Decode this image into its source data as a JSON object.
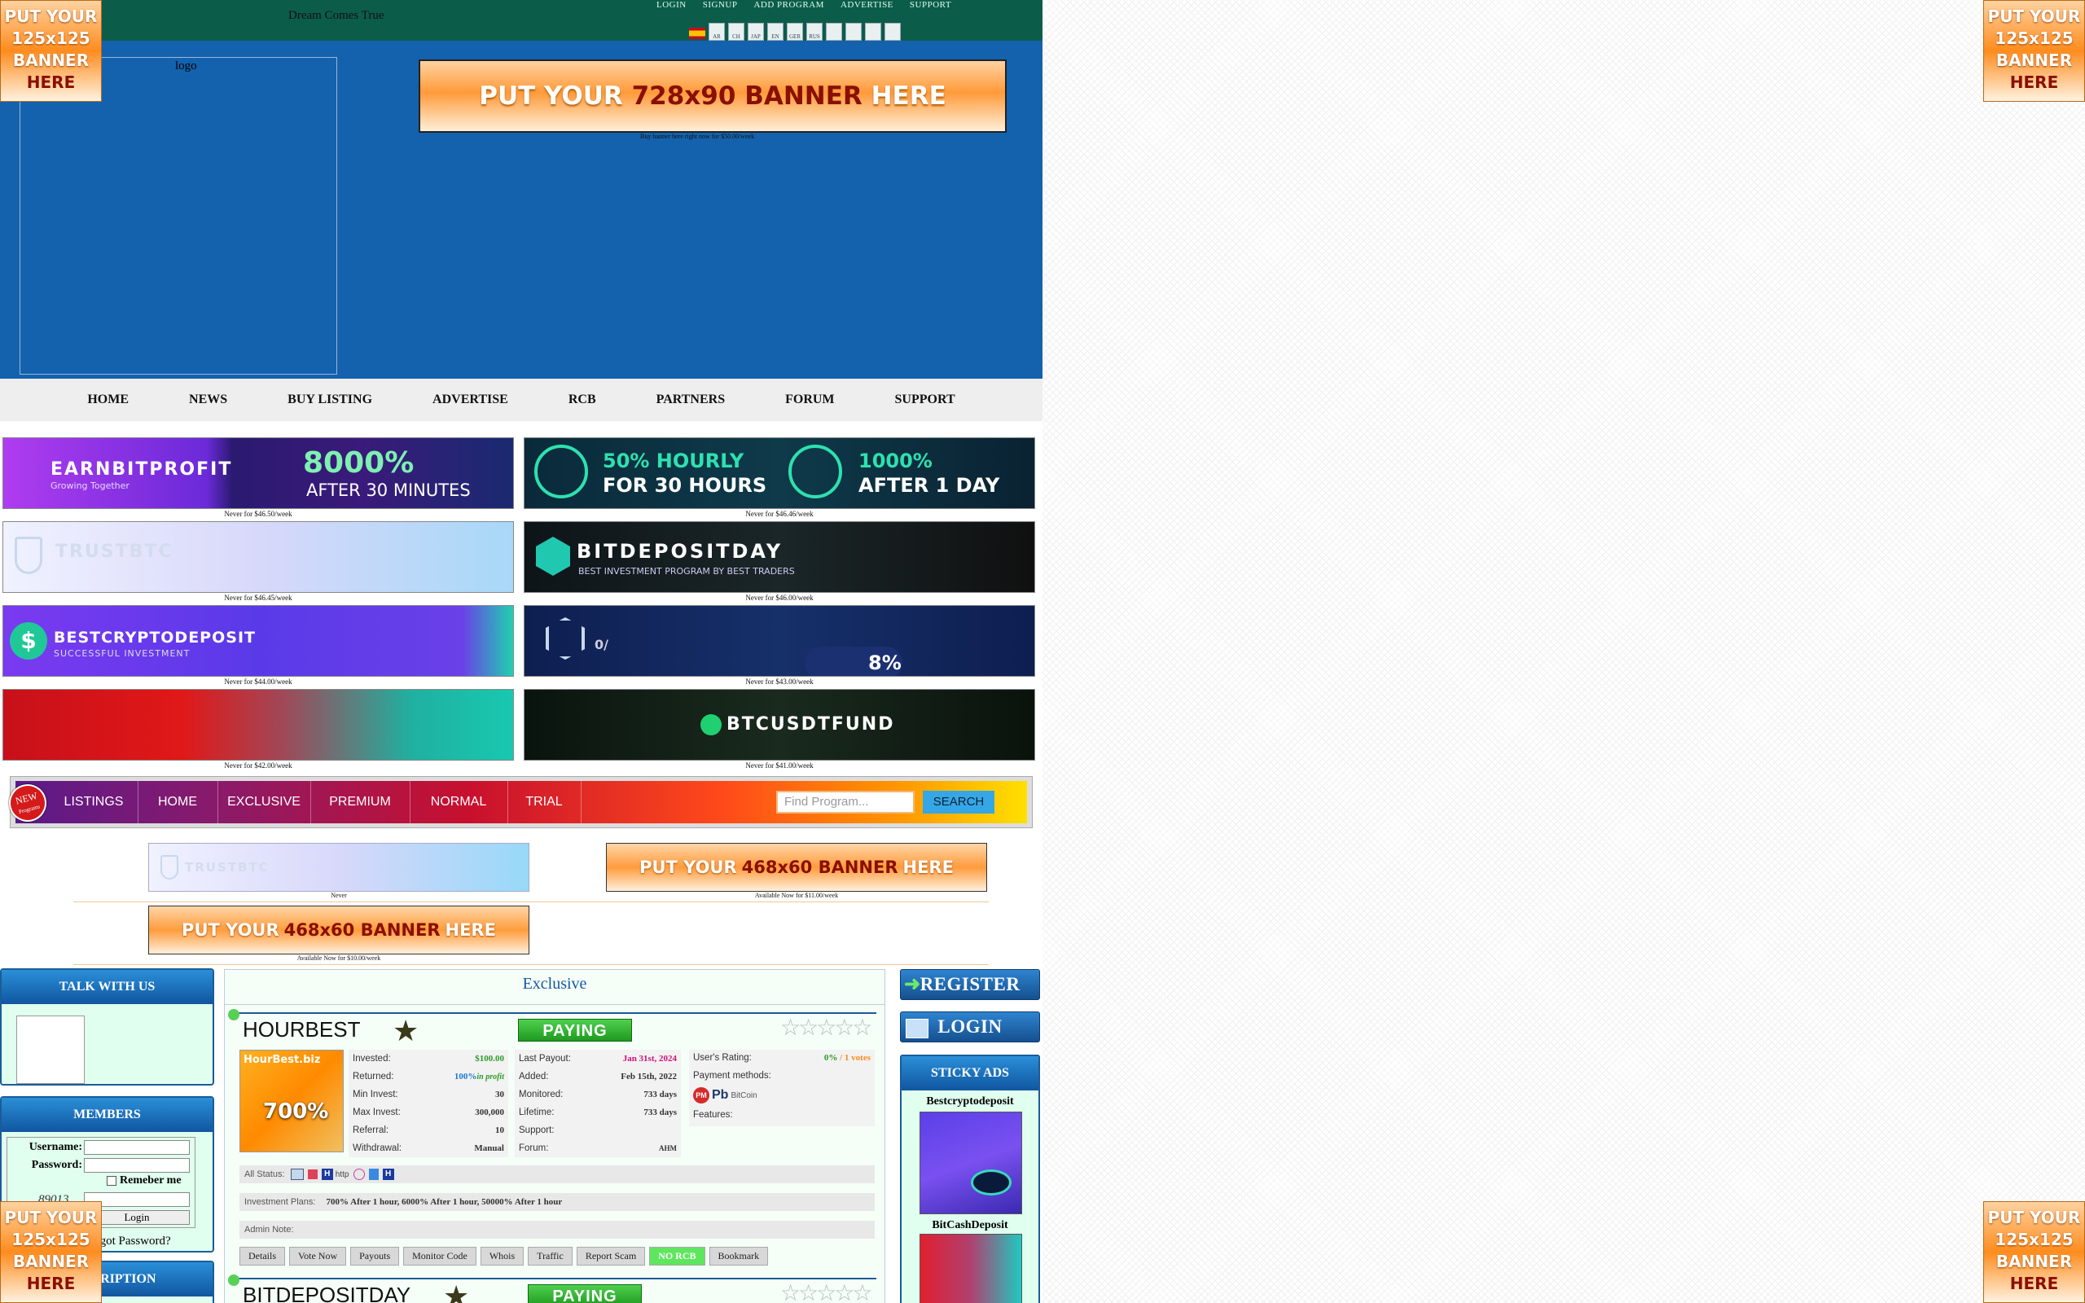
{
  "topbar": {
    "tagline": "Dream Comes True",
    "nav": [
      "LOGIN",
      "SIGNUP",
      "ADD PROGRAM",
      "ADVERTISE",
      "SUPPORT"
    ],
    "languages": [
      "AR",
      "CH",
      "JAP",
      "EN",
      "GER",
      "RUS",
      "",
      "",
      "",
      ""
    ]
  },
  "header": {
    "logo_alt": "logo",
    "banner728": {
      "pre": "PUT YOUR",
      "size": "728x90 BANNER",
      "post": "HERE"
    },
    "banner728_caption": "Buy banner here right now for $50.00/week"
  },
  "mainnav": [
    "HOME",
    "NEWS",
    "BUY LISTING",
    "ADVERTISE",
    "RCB",
    "PARTNERS",
    "FORUM",
    "SUPPORT"
  ],
  "ads": [
    {
      "name": "EARNBITPROFIT",
      "sub": "Growing Together",
      "promo1": "8000%",
      "promo2": "AFTER 30 MINUTES",
      "caption": "Never for $46.50/week"
    },
    {
      "name": "",
      "sub": "",
      "promo1": "50% HOURLY",
      "promo2": "FOR 30 HOURS",
      "promo3": "1000%",
      "promo4": "AFTER 1 DAY",
      "caption": "Never for $46.46/week"
    },
    {
      "name": "TRUSTBTC",
      "sub": "",
      "caption": "Never for $46.45/week"
    },
    {
      "name": "BITDEPOSITDAY",
      "sub": "BEST INVESTMENT PROGRAM BY BEST TRADERS",
      "caption": "Never for $46.00/week"
    },
    {
      "name": "BESTCRYPTODEPOSIT",
      "sub": "SUCCESSFUL INVESTMENT",
      "caption": "Never for $44.00/week"
    },
    {
      "name": "",
      "sub": "",
      "promo1": "0/",
      "promo2": "8%",
      "caption": "Never for $43.00/week"
    },
    {
      "name": "",
      "sub": "",
      "caption": "Never for $42.00/week"
    },
    {
      "name": "BTCUSDTFUND",
      "sub": "",
      "caption": "Never for $41.00/week"
    }
  ],
  "listbar": {
    "badge": "NEW",
    "badge_small": "Programs",
    "tabs": [
      "LISTINGS",
      "HOME",
      "EXCLUSIVE",
      "PREMIUM",
      "NORMAL",
      "TRIAL"
    ],
    "search_placeholder": "Find Program...",
    "search_button": "SEARCH"
  },
  "banners468": {
    "trust_caption": "Never",
    "slot": {
      "pre": "PUT YOUR",
      "size": "468x60 BANNER",
      "post": "HERE"
    },
    "caption1": "Available Now for $11.00/week",
    "caption2": "Available Now for $10.00/week",
    "trust_name": "TRUSTBTC"
  },
  "left": {
    "talk_title": "TALK WITH US",
    "members_title": "MEMBERS",
    "username_label": "Username:",
    "password_label": "Password:",
    "remember_label": "Remeber me",
    "captcha": "89013",
    "login_button": "Login",
    "forgot": "Forgot Password?",
    "third_title": "SUBSCRIPTION"
  },
  "center": {
    "section_title": "Exclusive",
    "card1": {
      "title": "HOURBEST",
      "status": "PAYING",
      "thumb_label": "HourBest.biz",
      "thumb_pct": "700%",
      "col1": [
        [
          "Invested:",
          "$100.00"
        ],
        [
          "Returned:",
          "100%"
        ],
        [
          "Min Invest:",
          "30"
        ],
        [
          "Max Invest:",
          "300,000"
        ],
        [
          "Referral:",
          "10"
        ],
        [
          "Withdrawal:",
          "Manual"
        ]
      ],
      "returned_note": "in profit",
      "col2": [
        [
          "Last Payout:",
          "Jan 31st, 2024"
        ],
        [
          "Added:",
          "Feb 15th, 2022"
        ],
        [
          "Monitored:",
          "733 days"
        ],
        [
          "Lifetime:",
          "733 days"
        ],
        [
          "Support:",
          ""
        ],
        [
          "Forum:",
          "AHM"
        ]
      ],
      "rating_label": "User's Rating:",
      "rating_pct": "0%",
      "rating_votes": "/ 1 votes",
      "payment_label": "Payment methods:",
      "payment_icons": [
        "PM",
        "Pb",
        "BitCoin"
      ],
      "features_label": "Features:",
      "allstatus_label": "All Status:",
      "allstatus_http": "http",
      "plans_label": "Investment Plans:",
      "plans_value": "700% After 1 hour, 6000% After 1 hour, 50000% After 1 hour",
      "admin_label": "Admin Note:",
      "buttons": [
        "Details",
        "Vote Now",
        "Payouts",
        "Monitor Code",
        "Whois",
        "Traffic",
        "Report Scam",
        "NO RCB",
        "Bookmark"
      ]
    },
    "card2": {
      "title": "BITDEPOSITDAY",
      "status": "PAYING"
    }
  },
  "right": {
    "register": "REGISTER",
    "login": "LOGIN",
    "sticky_title": "STICKY ADS",
    "sticky1": "Bestcryptodeposit",
    "sticky2": "BitCashDeposit"
  },
  "corner": {
    "line1": "PUT YOUR",
    "line2": "125x125",
    "line3": "BANNER",
    "line4": "HERE"
  },
  "colors": {
    "topbar": "#0c5c4a",
    "header": "#1462ad",
    "accent_blue": "#1558a0",
    "paying_green": "#2faa2f"
  }
}
